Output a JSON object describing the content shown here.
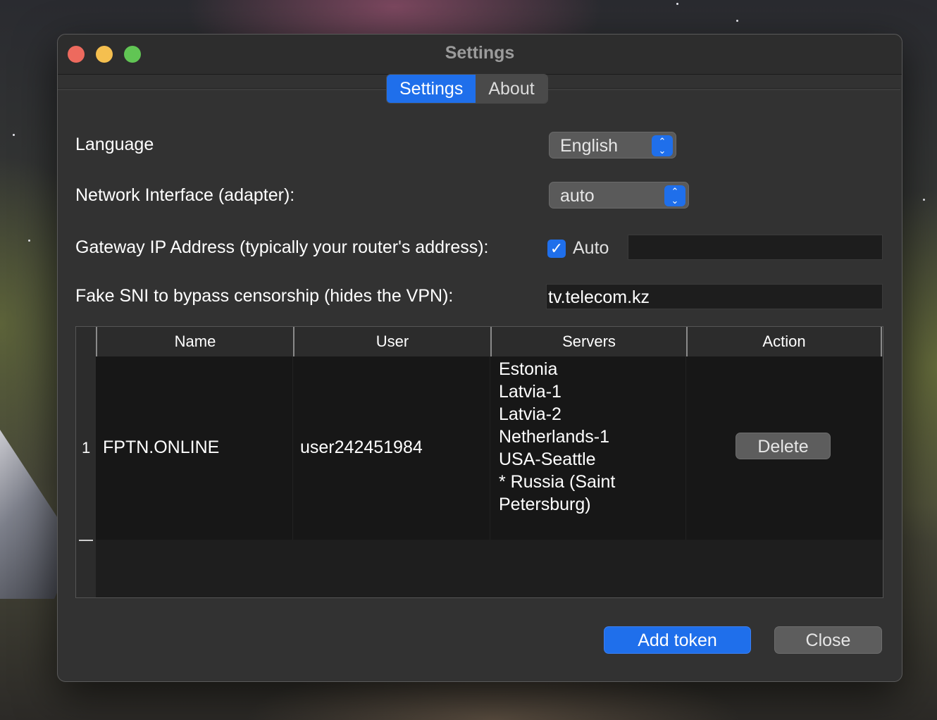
{
  "window": {
    "title": "Settings"
  },
  "tabs": [
    {
      "label": "Settings",
      "active": true
    },
    {
      "label": "About",
      "active": false
    }
  ],
  "form": {
    "language_label": "Language",
    "language_value": "English",
    "network_label": "Network Interface (adapter):",
    "network_value": "auto",
    "gateway_label": "Gateway IP Address (typically your router's address):",
    "gateway_auto_label": "Auto",
    "gateway_auto_checked": true,
    "gateway_value": "",
    "sni_label": "Fake SNI to bypass censorship (hides the VPN):",
    "sni_value": "tv.telecom.kz"
  },
  "table": {
    "columns": [
      "Name",
      "User",
      "Servers",
      "Action"
    ],
    "rows": [
      {
        "index": "1",
        "name": "FPTN.ONLINE",
        "user": "user242451984",
        "servers": [
          "Estonia",
          "Latvia-1",
          "Latvia-2",
          "Netherlands-1",
          "USA-Seattle",
          "* Russia (Saint",
          "Petersburg)"
        ],
        "action_label": "Delete"
      }
    ]
  },
  "buttons": {
    "add_token": "Add token",
    "close": "Close"
  },
  "colors": {
    "accent": "#1f6feb",
    "window_bg": "#323232",
    "table_bg": "#171717"
  },
  "icons": {
    "popup_arrows": "chevron-up-down-icon",
    "checkbox": "checkmark-icon"
  }
}
